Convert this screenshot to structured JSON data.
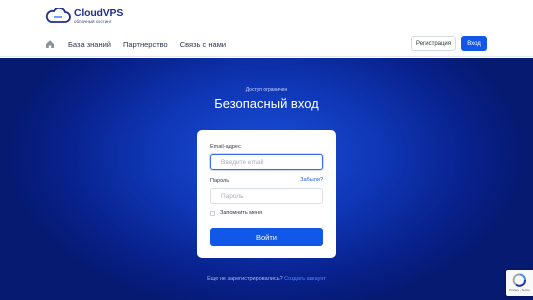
{
  "brand": {
    "name": "CloudVPS",
    "tagline": "облачный хостинг"
  },
  "nav": {
    "items": [
      "База знаний",
      "Партнерство",
      "Связь с нами"
    ],
    "register_label": "Регистрация",
    "login_label": "Вход"
  },
  "hero": {
    "notice": "Доступ ограничен",
    "title": "Безопасный вход"
  },
  "form": {
    "email_label": "Email-адрес",
    "email_placeholder": "Введите email",
    "password_label": "Пароль",
    "forgot_label": "Забыли?",
    "password_placeholder": "Пароль",
    "remember_label": "Запомнить меня",
    "submit_label": "Войти"
  },
  "footer": {
    "question": "Еще не зарегистрировались?",
    "create_link": "Создать аккаунт"
  },
  "recaptcha": {
    "text": "Privacy - Terms"
  },
  "colors": {
    "primary": "#1258e8",
    "hero_dark": "#08208a",
    "brand_text": "#1e2f8f"
  }
}
